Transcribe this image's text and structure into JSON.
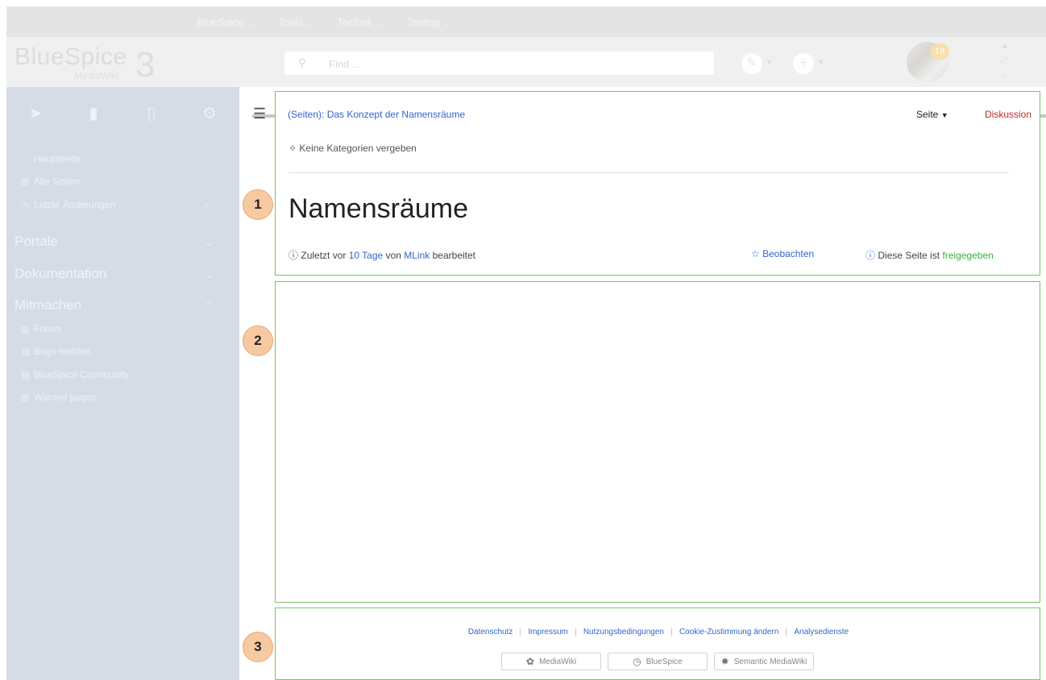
{
  "topnav": {
    "items": [
      {
        "label": "BlueSpice"
      },
      {
        "label": "Tools"
      },
      {
        "label": "Technik"
      },
      {
        "label": "Testing"
      }
    ]
  },
  "header": {
    "logo_text": "BlueSpice",
    "logo_sub": "MediaWiki",
    "logo_version": "3",
    "search_placeholder": "Find ...",
    "notification_count": "19"
  },
  "sidebar": {
    "tabs": [
      {
        "icon": "navigation-icon"
      },
      {
        "icon": "book-icon"
      },
      {
        "icon": "clipboard-icon"
      },
      {
        "icon": "gear-icon"
      }
    ],
    "nav_items": [
      {
        "label": "Hauptseite",
        "icon": "home-icon"
      },
      {
        "label": "Alle Seiten",
        "icon": "page-icon"
      },
      {
        "label": "Letzte Änderungen",
        "icon": "clock-icon"
      }
    ],
    "sections": [
      {
        "label": "Portale"
      },
      {
        "label": "Dokumentation"
      },
      {
        "label": "Mitmachen"
      }
    ],
    "mitmachen_items": [
      {
        "label": "Forum"
      },
      {
        "label": "Bugs melden"
      },
      {
        "label": "BlueSpice Community"
      },
      {
        "label": "Wanted pages"
      }
    ]
  },
  "content": {
    "breadcrumb_prefix": "(Seiten):",
    "breadcrumb_link": "Das Konzept der Namensräume",
    "tab_page": "Seite",
    "tab_discussion": "Diskussion",
    "categories": "Keine Kategorien vergeben",
    "title": "Namensräume",
    "meta_prefix": "Zuletzt vor",
    "meta_time": "10 Tage",
    "meta_von": "von",
    "meta_user": "MLink",
    "meta_suffix": "bearbeitet",
    "watch": "Beobachten",
    "approved_prefix": "Diese Seite ist",
    "approved_status": "freigegeben"
  },
  "footer": {
    "links": [
      {
        "label": "Datenschutz"
      },
      {
        "label": "Impressum"
      },
      {
        "label": "Nutzungsbedingungen"
      },
      {
        "label": "Cookie-Zustimmung ändern"
      },
      {
        "label": "Analysedienste"
      }
    ],
    "badges": [
      {
        "label": "MediaWiki"
      },
      {
        "label": "BlueSpice"
      },
      {
        "label": "Semantic MediaWiki"
      }
    ]
  },
  "callouts": [
    "1",
    "2",
    "3"
  ],
  "colors": {
    "link": "#3366cc",
    "discussion": "#c0292c",
    "approved": "#37b23b",
    "box_border": "#7ac26a",
    "callout": "#f7c9a1",
    "sidebar": "#d6dce6"
  }
}
